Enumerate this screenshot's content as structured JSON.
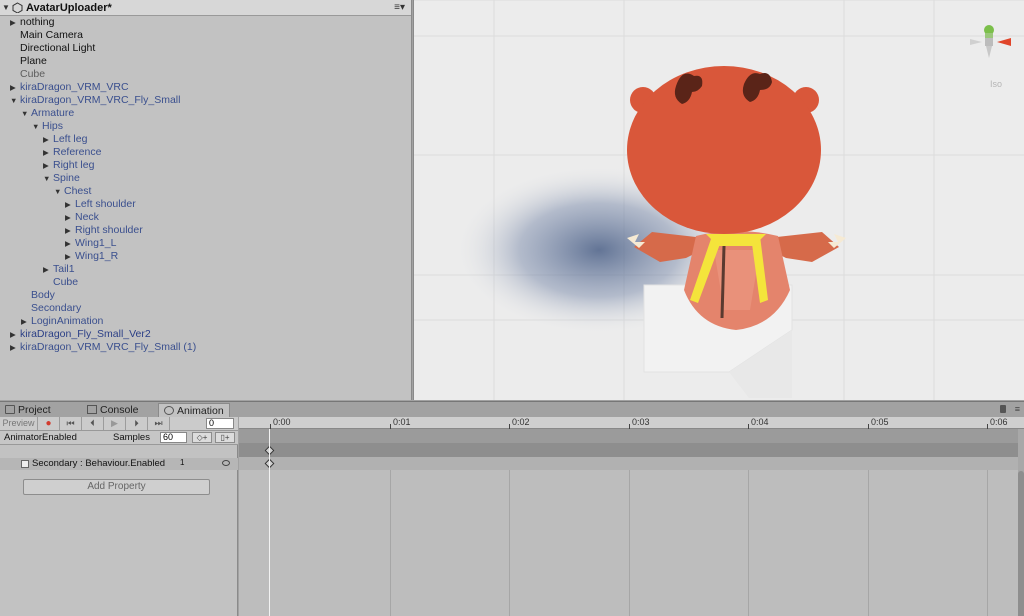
{
  "hierarchy": {
    "scene_title": "AvatarUploader*",
    "items": [
      {
        "label": "nothing",
        "style": "black",
        "arrow": "▶"
      },
      {
        "label": "Main Camera",
        "style": "black",
        "arrow": ""
      },
      {
        "label": "Directional Light",
        "style": "black",
        "arrow": ""
      },
      {
        "label": "Plane",
        "style": "black",
        "arrow": ""
      },
      {
        "label": "Cube",
        "style": "grey",
        "arrow": ""
      },
      {
        "label": "kiraDragon_VRM_VRC",
        "style": "blue",
        "arrow": "▶"
      },
      {
        "label": "kiraDragon_VRM_VRC_Fly_Small",
        "style": "blue",
        "arrow": "▼"
      },
      {
        "label": "Armature",
        "style": "blue",
        "arrow": "▼"
      },
      {
        "label": "Hips",
        "style": "blue",
        "arrow": "▼"
      },
      {
        "label": "Left leg",
        "style": "blue",
        "arrow": "▶"
      },
      {
        "label": "Reference",
        "style": "blue",
        "arrow": "▶"
      },
      {
        "label": "Right leg",
        "style": "blue",
        "arrow": "▶"
      },
      {
        "label": "Spine",
        "style": "blue",
        "arrow": "▼"
      },
      {
        "label": "Chest",
        "style": "blue",
        "arrow": "▼"
      },
      {
        "label": "Left shoulder",
        "style": "blue",
        "arrow": "▶"
      },
      {
        "label": "Neck",
        "style": "blue",
        "arrow": "▶"
      },
      {
        "label": "Right shoulder",
        "style": "blue",
        "arrow": "▶"
      },
      {
        "label": "Wing1_L",
        "style": "blue",
        "arrow": "▶"
      },
      {
        "label": "Wing1_R",
        "style": "blue",
        "arrow": "▶"
      },
      {
        "label": "Tail1",
        "style": "blue",
        "arrow": "▶"
      },
      {
        "label": "Cube",
        "style": "blue",
        "arrow": ""
      },
      {
        "label": "Body",
        "style": "blue",
        "arrow": ""
      },
      {
        "label": "Secondary",
        "style": "blue",
        "arrow": ""
      },
      {
        "label": "LoginAnimation",
        "style": "blue",
        "arrow": "▶"
      },
      {
        "label": "kiraDragon_Fly_Small_Ver2",
        "style": "blue2",
        "arrow": "▶"
      },
      {
        "label": "kiraDragon_VRM_VRC_Fly_Small (1)",
        "style": "blue",
        "arrow": "▶"
      }
    ]
  },
  "scene": {
    "gizmo_label": "Iso"
  },
  "tabs": {
    "project": "Project",
    "console": "Console",
    "animation": "Animation"
  },
  "animation": {
    "preview_label": "Preview",
    "frame_value": "0",
    "clip_name": "AnimatorEnabled",
    "samples_label": "Samples",
    "samples_value": "60",
    "property_label": "Secondary : Behaviour.Enabled",
    "property_value": "1",
    "add_property_label": "Add Property",
    "ticks": [
      "0:00",
      "0:01",
      "0:02",
      "0:03",
      "0:04",
      "0:05",
      "0:06"
    ]
  },
  "colors": {
    "dragon_body": "#d9573a",
    "dragon_horn": "#5a2418",
    "ribbon": "#f4e43b",
    "gizmo_y": "#7bbf4a",
    "gizmo_x": "#e0452a"
  }
}
